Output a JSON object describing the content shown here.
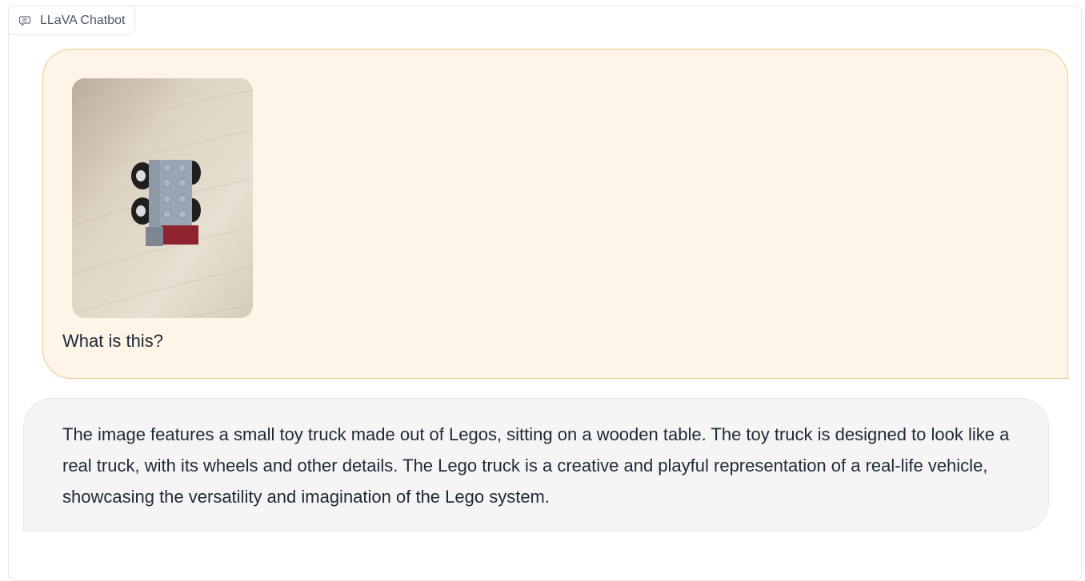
{
  "chatbot": {
    "label": "LLaVA Chatbot",
    "label_icon": "chat-icon"
  },
  "messages": [
    {
      "role": "user",
      "image_alt": "small toy truck made out of Legos on a wooden table",
      "text": "What is this?"
    },
    {
      "role": "assistant",
      "text": "The image features a small toy truck made out of Legos, sitting on a wooden table. The toy truck is designed to look like a real truck, with its wheels and other details. The Lego truck is a creative and playful representation of a real-life vehicle, showcasing the versatility and imagination of the Lego system."
    }
  ],
  "colors": {
    "user_bubble_bg": "#fff4e8",
    "user_bubble_border": "#f0c98a",
    "bot_bubble_bg": "#f5f5f6",
    "bot_bubble_border": "#e5e7eb"
  }
}
